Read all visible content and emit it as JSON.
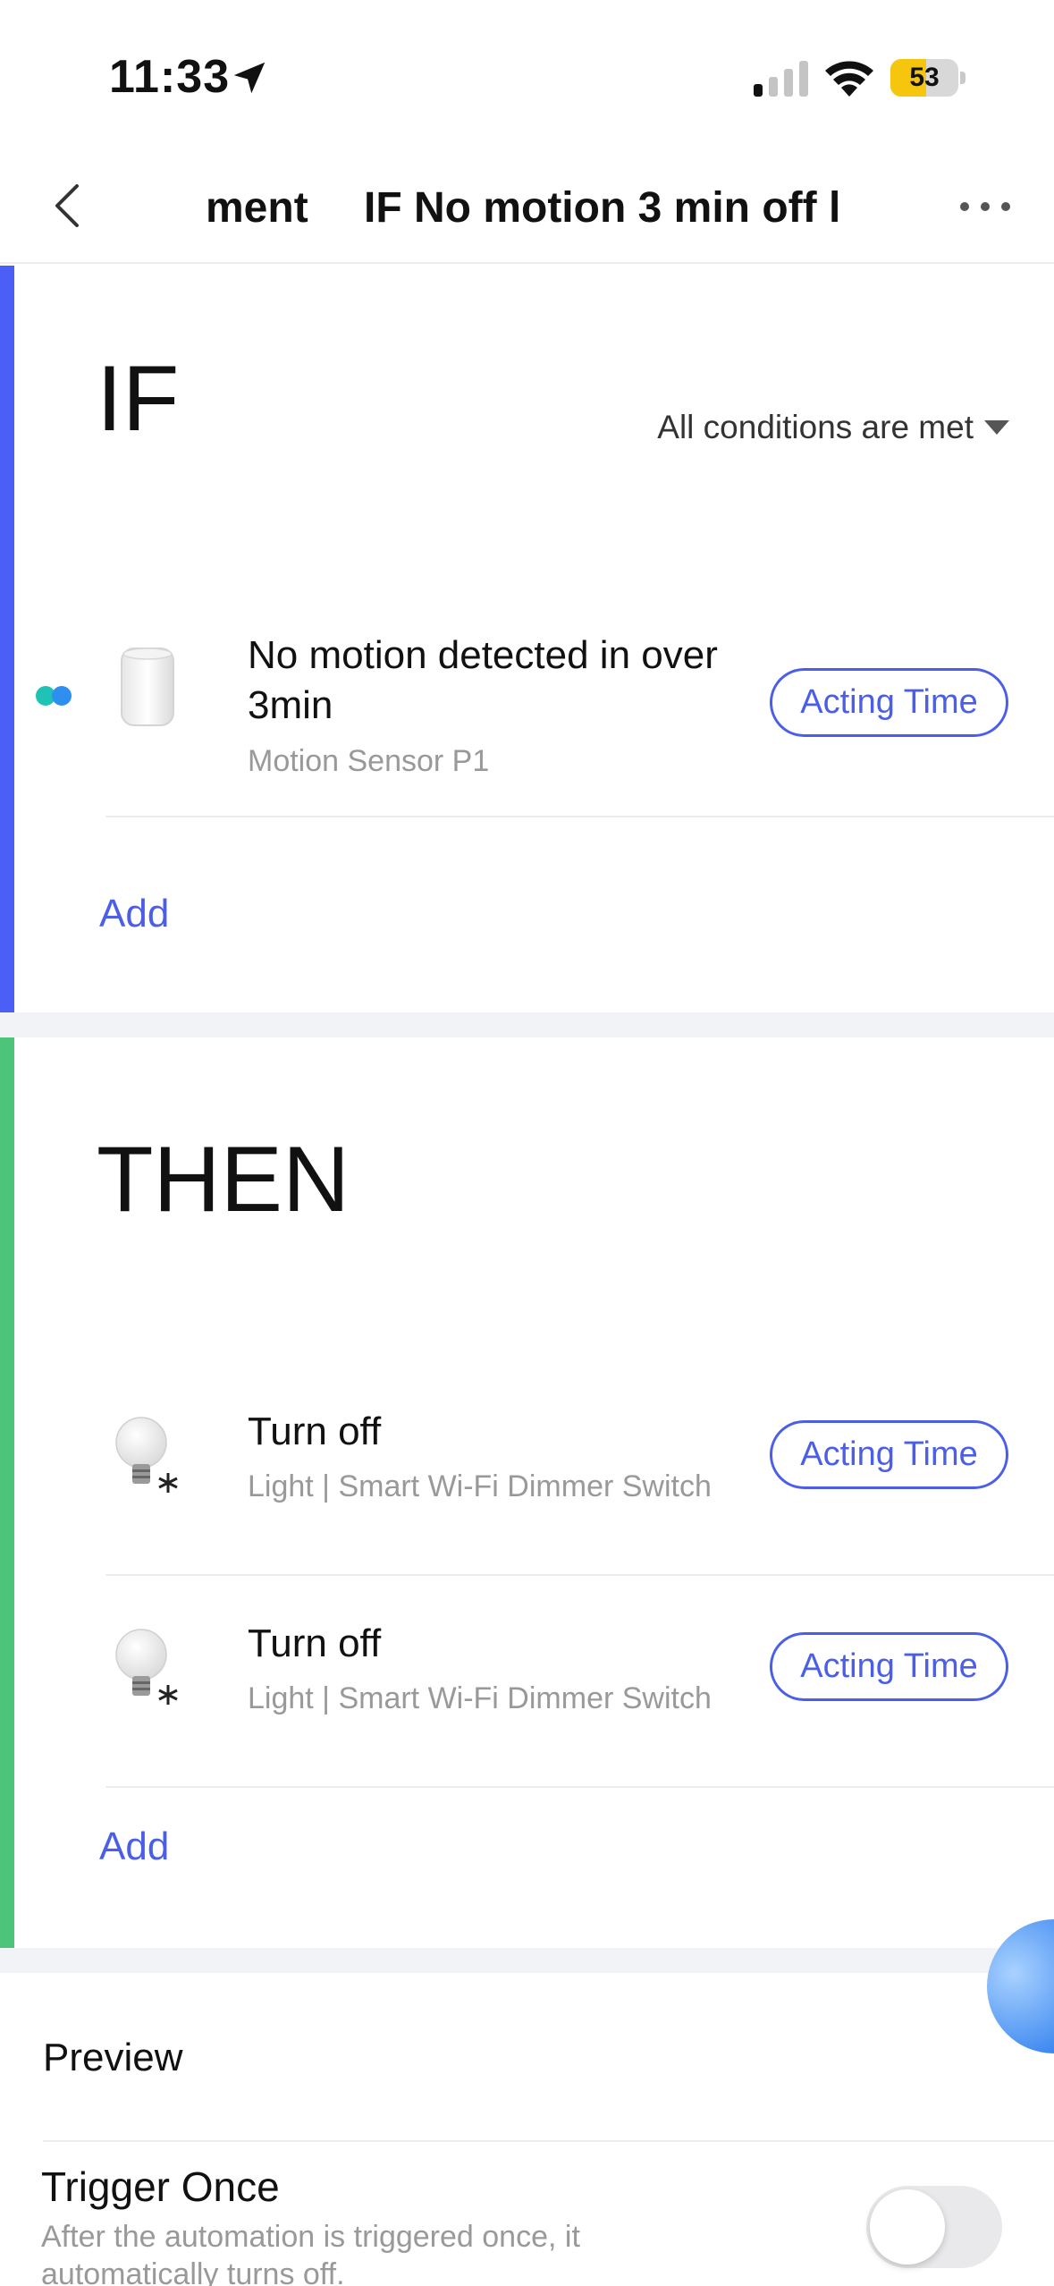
{
  "status_bar": {
    "time": "11:33",
    "battery_percent": "53",
    "battery_level": 0.53
  },
  "nav": {
    "prev_title": "ment",
    "title": "IF No motion 3 min off l"
  },
  "if_section": {
    "title": "IF",
    "condition_mode": "All conditions are met",
    "items": [
      {
        "title": "No motion detected in over 3min",
        "subtitle": "Motion Sensor P1",
        "action_label": "Acting Time"
      }
    ],
    "add_label": "Add"
  },
  "then_section": {
    "title": "THEN",
    "items": [
      {
        "title": "Turn off",
        "subtitle": "Light | Smart Wi-Fi Dimmer Switch",
        "action_label": "Acting Time"
      },
      {
        "title": "Turn off",
        "subtitle": "Light | Smart Wi-Fi Dimmer Switch",
        "action_label": "Acting Time"
      }
    ],
    "add_label": "Add"
  },
  "preview": {
    "label": "Preview"
  },
  "trigger_once": {
    "title": "Trigger Once",
    "description": "After the automation is triggered once, it automatically turns off.",
    "enabled": false
  },
  "colors": {
    "if_accent": "#4b5ef5",
    "then_accent": "#4cc47a",
    "link": "#4b5ee8",
    "section_gap": "#f2f3f6"
  }
}
